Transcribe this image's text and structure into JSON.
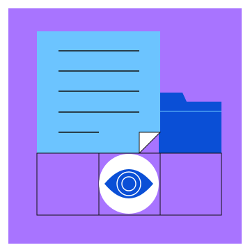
{
  "illustration": {
    "icons": [
      "document-icon",
      "folder-icon",
      "eye-icon"
    ],
    "colors": {
      "background_panel": "#A874FF",
      "document_fill": "#6CC4FF",
      "folder_fill": "#0A4FD6",
      "folder_dark": "#0A3FC0",
      "eye_circle": "#FFFFFF",
      "eye_fill": "#0A4FD6",
      "line_color": "#111111",
      "page_fold": "#FFFFFF"
    }
  }
}
